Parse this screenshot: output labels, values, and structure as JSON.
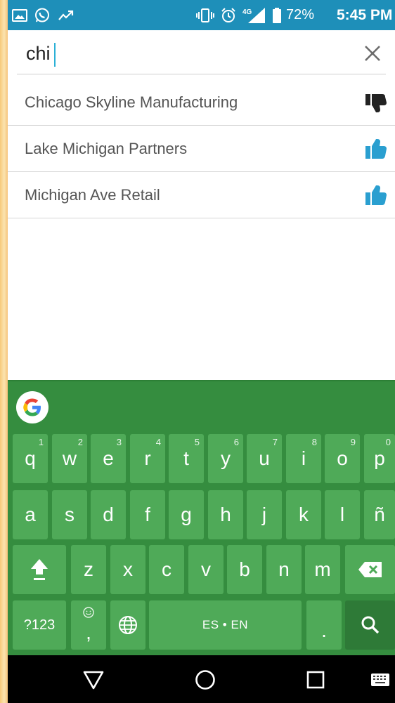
{
  "status_bar": {
    "battery_percent": "72%",
    "time": "5:45 PM",
    "network": "4G",
    "icons": [
      "image-icon",
      "whatsapp-icon",
      "trending-icon",
      "vibrate-icon",
      "alarm-icon",
      "signal-icon",
      "battery-icon"
    ]
  },
  "search": {
    "query": "chi",
    "clear_icon": "close-icon"
  },
  "results": [
    {
      "label": "Chicago Skyline Manufacturing",
      "icon": "thumbs-down-icon",
      "icon_color": "#222222"
    },
    {
      "label": "Lake Michigan Partners",
      "icon": "thumbs-up-icon",
      "icon_color": "#2a9fd0"
    },
    {
      "label": "Michigan Ave Retail",
      "icon": "thumbs-up-icon",
      "icon_color": "#2a9fd0"
    }
  ],
  "keyboard": {
    "row1": [
      {
        "key": "q",
        "hint": "1"
      },
      {
        "key": "w",
        "hint": "2"
      },
      {
        "key": "e",
        "hint": "3"
      },
      {
        "key": "r",
        "hint": "4"
      },
      {
        "key": "t",
        "hint": "5"
      },
      {
        "key": "y",
        "hint": "6"
      },
      {
        "key": "u",
        "hint": "7"
      },
      {
        "key": "i",
        "hint": "8"
      },
      {
        "key": "o",
        "hint": "9"
      },
      {
        "key": "p",
        "hint": "0"
      }
    ],
    "row2": [
      "a",
      "s",
      "d",
      "f",
      "g",
      "h",
      "j",
      "k",
      "l",
      "ñ"
    ],
    "row3": [
      "z",
      "x",
      "c",
      "v",
      "b",
      "n",
      "m"
    ],
    "symbols_label": "?123",
    "comma_label": ",",
    "space_label": "ES • EN",
    "period_label": ".",
    "colors": {
      "keyboard_bg": "#358d3f",
      "key_bg": "#4faa58",
      "search_key_bg": "#2e7a37"
    }
  },
  "navbar": {
    "icons": [
      "back-icon",
      "home-icon",
      "recents-icon",
      "keyboard-icon"
    ]
  },
  "colors": {
    "status_bar": "#1e8fb9",
    "accent": "#2bb0d6"
  }
}
